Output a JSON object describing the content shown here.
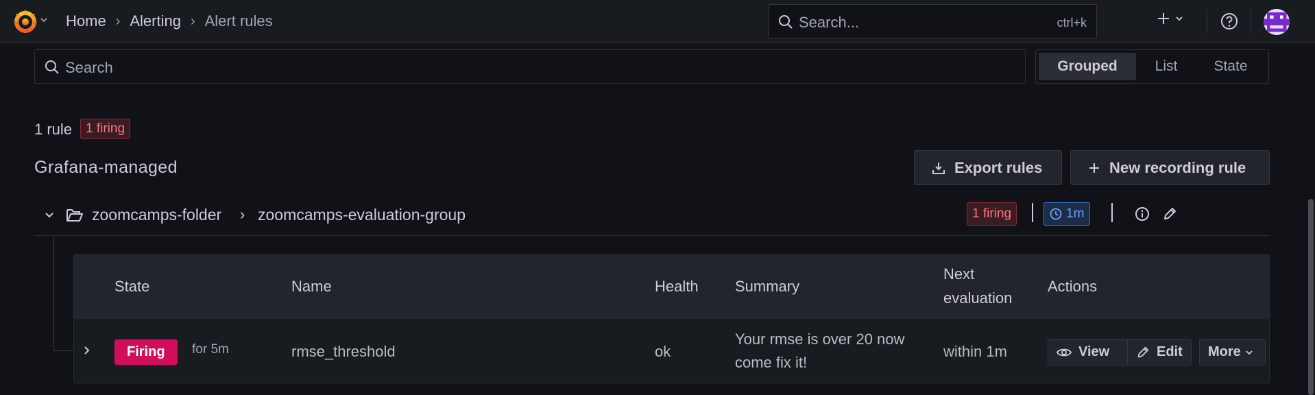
{
  "breadcrumbs": [
    "Home",
    "Alerting",
    "Alert rules"
  ],
  "global_search": {
    "placeholder": "Search...",
    "shortcut": "ctrl+k"
  },
  "rules_search": {
    "placeholder": "Search"
  },
  "view_modes": [
    "Grouped",
    "List",
    "State"
  ],
  "view_mode_active": "Grouped",
  "summary": {
    "rule_count": "1 rule",
    "firing": "1 firing"
  },
  "section": {
    "title": "Grafana-managed",
    "export_label": "Export rules",
    "new_recording_label": "New recording rule"
  },
  "group": {
    "folder": "zoomcamps-folder",
    "separator": "›",
    "name": "zoomcamps-evaluation-group",
    "firing": "1 firing",
    "interval": "1m"
  },
  "table": {
    "headers": {
      "state": "State",
      "name": "Name",
      "health": "Health",
      "summary": "Summary",
      "next_eval_line1": "Next",
      "next_eval_line2": "evaluation",
      "actions": "Actions"
    },
    "rows": [
      {
        "state": "Firing",
        "duration": "for 5m",
        "name": "rmse_threshold",
        "health": "ok",
        "summary_line1": "Your rmse is over 20 now",
        "summary_line2": "come fix it!",
        "next_evaluation": "within 1m",
        "actions": {
          "view": "View",
          "edit": "Edit",
          "more": "More"
        }
      }
    ]
  },
  "colors": {
    "background": "#111217",
    "panel": "#181b1f",
    "firing": "#d10e5c",
    "firing_badge_text": "#ff7383",
    "interval_badge": "#6e9fff"
  }
}
